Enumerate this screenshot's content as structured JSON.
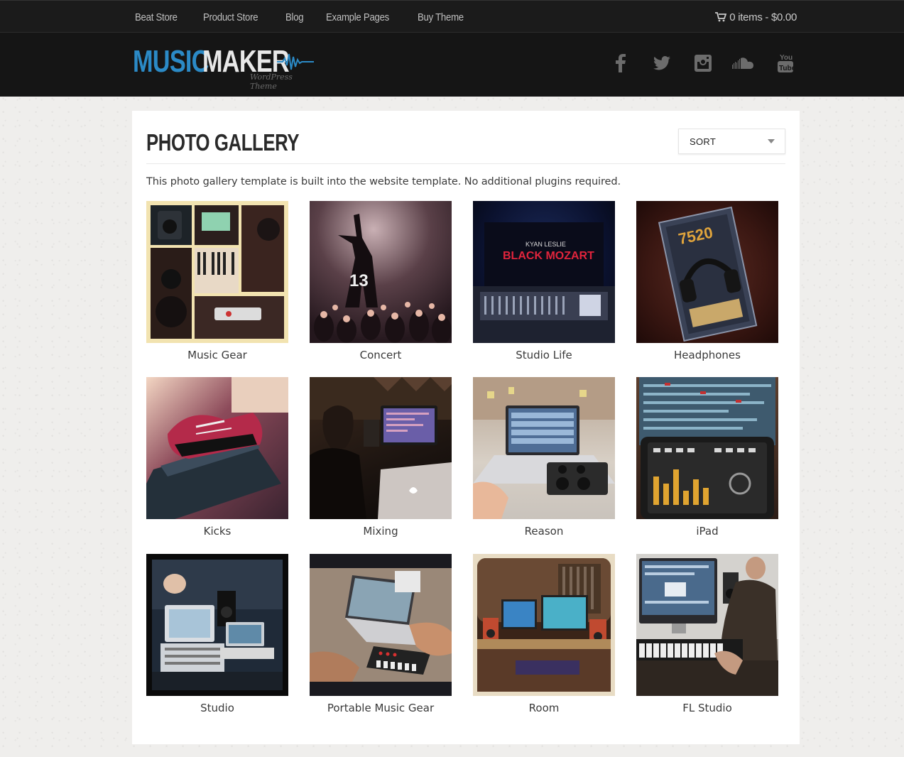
{
  "nav": {
    "items": [
      "Beat Store",
      "Product Store",
      "Blog",
      "Example Pages",
      "Buy Theme"
    ],
    "cart": "0 items - $0.00"
  },
  "logo": {
    "word1": "MUSIC",
    "word2": "MAKER",
    "tagline": "WordPress Theme"
  },
  "social": [
    "facebook-icon",
    "twitter-icon",
    "instagram-icon",
    "soundcloud-icon",
    "youtube-icon"
  ],
  "page": {
    "title": "PHOTO GALLERY",
    "sort_label": "SORT",
    "intro": "This photo gallery template is built into the website template. No additional plugins required."
  },
  "gallery": [
    "Music Gear",
    "Concert",
    "Studio Life",
    "Headphones",
    "Kicks",
    "Mixing",
    "Reason",
    "iPad",
    "Studio",
    "Portable Music Gear",
    "Room",
    "FL Studio"
  ],
  "thumb_overlay": {
    "studio_life": "BLACK MOZART",
    "studio_life_top": "KYAN LESLIE",
    "headphones": "7520"
  },
  "colors": {
    "brand_blue": "#2b8ac6",
    "topbar": "#1b1b1b",
    "header": "#151515"
  }
}
